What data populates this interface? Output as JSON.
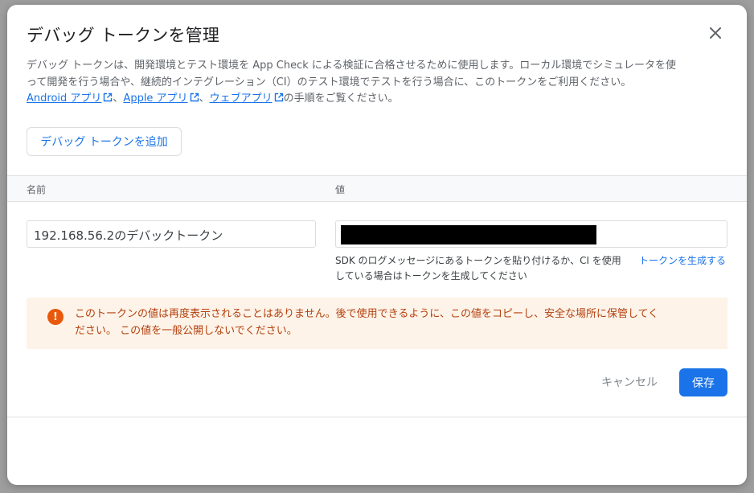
{
  "dialog": {
    "title": "デバッグ トークンを管理",
    "description_line1": "デバッグ トークンは、開発環境とテスト環境を App Check による検証に合格させるために使用します。ローカル環境でシミュレータを使",
    "description_line2": "って開発を行う場合や、継続的インテグレーション（CI）のテスト環境でテストを行う場合に、このトークンをご利用ください。",
    "links": {
      "android": "Android アプリ",
      "apple": "Apple アプリ",
      "web": "ウェブアプリ",
      "separator": "、",
      "suffix": "の手順をご覧ください。"
    },
    "add_button": "デバッグ トークンを追加",
    "table": {
      "header_name": "名前",
      "header_value": "値"
    },
    "name_value": "192.168.56.2のデバックトークン",
    "value_hint_line1": "SDK のログメッセージにあるトークンを貼り付けるか、CI を使用",
    "value_hint_line2": "している場合はトークンを生成してください",
    "generate_link": "トークンを生成する",
    "warning_line1": "このトークンの値は再度表示されることはありません。後で使用できるように、この値をコピーし、安全な場所に保管してく",
    "warning_line2": "ださい。 この値を一般公開しないでください。",
    "warning_icon_glyph": "!",
    "cancel_button": "キャンセル",
    "save_button": "保存"
  },
  "icons": {
    "close": "close-icon",
    "external_link": "external-link-icon",
    "warning": "error-icon"
  },
  "colors": {
    "accent": "#1a73e8",
    "warning_bg": "#fef3e8",
    "warning_text": "#b3410f",
    "warning_icon": "#e8590c"
  }
}
